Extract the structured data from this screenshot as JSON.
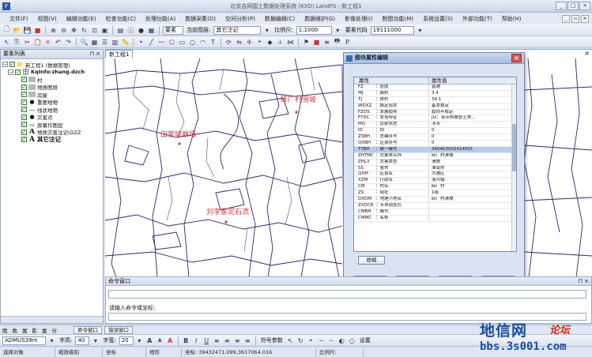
{
  "window": {
    "title": "北京吉网国土数据处理系统 (KXD) LandFS - 新工程1",
    "buttons": [
      "_",
      "□",
      "×"
    ]
  },
  "menubar": {
    "items": [
      "文件(F)",
      "视图(V)",
      "编辑功能(E)",
      "检查功能(C)",
      "处理功能(A)",
      "数据采集(D)",
      "空间分析(P)",
      "数据编辑(C)",
      "数据维护(G)",
      "影像处理(I)",
      "制图功能(M)",
      "系统设置(S)",
      "外部功能(T)",
      "帮助(H)"
    ]
  },
  "toolbar1": {
    "layer_label": "当前图层:",
    "layer_value": "其它注记",
    "scale_label": "比例尺:",
    "scale_value": "1:1000",
    "code_label": "要素代码",
    "code_value": "19111000",
    "type_value": "要素"
  },
  "left_pane": {
    "title": "要素列表",
    "tree": [
      {
        "label": "新工程1 (数据管理)",
        "level": 0,
        "icon": "expand"
      },
      {
        "label": "KqInfo:zhang.dzch",
        "level": 1,
        "icon": "expand"
      },
      {
        "label": "村",
        "level": 2,
        "icon": "grey"
      },
      {
        "label": "地质图斑",
        "level": 2,
        "icon": "grey"
      },
      {
        "label": "房屋",
        "level": 2,
        "icon": "grey"
      },
      {
        "label": "重要地物",
        "level": 2,
        "icon": "dot"
      },
      {
        "label": "线状地物",
        "level": 2,
        "icon": "line"
      },
      {
        "label": "灾害点",
        "level": 2,
        "icon": "dot"
      },
      {
        "label": "屏幕作图层",
        "level": 2,
        "icon": "rect"
      },
      {
        "label": "地质灾害注记(DZZ",
        "level": 2,
        "icon": "A"
      },
      {
        "label": "其它注记",
        "level": 2,
        "icon": "A"
      }
    ]
  },
  "document": {
    "tab": "新工程1",
    "map_labels": [
      "砖厂村滑坡",
      "田家坡崩塌",
      "刘李家泥石流"
    ]
  },
  "dialog": {
    "title": "图块属性编辑",
    "col_field": "属性",
    "col_value": "属性值",
    "rows": [
      {
        "code": "FZ",
        "name": "：密度",
        "value": "普通"
      },
      {
        "code": "MJ",
        "name": "：面积",
        "value": "3.4"
      },
      {
        "code": "TJ",
        "name": "：体积",
        "value": "34.1"
      },
      {
        "code": "WDXZ",
        "name": "：稳定现状",
        "value": "基本稳定"
      },
      {
        "code": "FZQS",
        "name": "：发展趋势",
        "value": "趋向不稳定"
      },
      {
        "code": "FYDC",
        "name": "：发育特征",
        "value": "jlx：该点斜坡岩土类..."
      },
      {
        "code": "MQ",
        "name": "：目前状态",
        "value": "涉水"
      },
      {
        "code": "ID",
        "name": "：ID",
        "value": "0"
      },
      {
        "code": "ZSBH",
        "name": "：总编序号",
        "value": "0"
      },
      {
        "code": "QXBH",
        "name": "：区县序号",
        "value": "0"
      },
      {
        "code": "TYBH",
        "name": "：统一编号",
        "value": "340403002014001"
      },
      {
        "code": "ZHTMC",
        "name": "：灾害体名称",
        "value": "砖厂村滑坡"
      },
      {
        "code": "ZHLX",
        "name": "：灾害类型",
        "value": "滑坡"
      },
      {
        "code": "SS",
        "name": "：省市",
        "value": "淮南市"
      },
      {
        "code": "QXM",
        "name": "：区县名",
        "value": "大通区"
      },
      {
        "code": "XZM",
        "name": "：行政名",
        "value": "洛河镇"
      },
      {
        "code": "CM",
        "name": "：村名",
        "value": "砖厂村"
      },
      {
        "code": "ZS",
        "name": "：组社",
        "value": "1组"
      },
      {
        "code": "DXDM",
        "name": "：地理小地名",
        "value": "砖厂村滑坡"
      },
      {
        "code": "ZXDCR",
        "name": "：专项调查任",
        "value": ""
      },
      {
        "code": "CMBH",
        "name": "：编号",
        "value": ""
      },
      {
        "code": "CMMC",
        "name": "：名称",
        "value": ""
      }
    ],
    "selected_index": 10,
    "collapse_btn": "收缩",
    "buttons": [
      "复制",
      "粘贴",
      "确定",
      "关闭"
    ]
  },
  "command_pane": {
    "title": "命令窗口",
    "prompt": "请输入命令或坐标:"
  },
  "tabs_row": {
    "left_tabs": [
      "图",
      "数",
      "属",
      "影",
      "属",
      "分"
    ],
    "bottom_tabs": [
      "命令窗口",
      "错误窗口"
    ]
  },
  "format_bar": {
    "font_value": "ADMUS39m",
    "size_label1": "字高:",
    "size_value1": "40",
    "size_label2": "字宽:",
    "size_value2": "20",
    "symbol_label": "符号参数",
    "settings_label": "设置"
  },
  "status_bar": {
    "items": [
      "选择对象",
      "缩放级别",
      "坐标",
      "地形",
      "坐标: 39432471.099,3617064.016",
      "比例尺:"
    ]
  },
  "watermark": {
    "title": "地信网",
    "forum": "论坛",
    "url": "bbs.3s001.com"
  },
  "colors": {
    "map_lines": "#3c1f6e",
    "map_labels": "#d0393e",
    "selection": "#b9cdea",
    "chrome": "#d6dfef"
  }
}
